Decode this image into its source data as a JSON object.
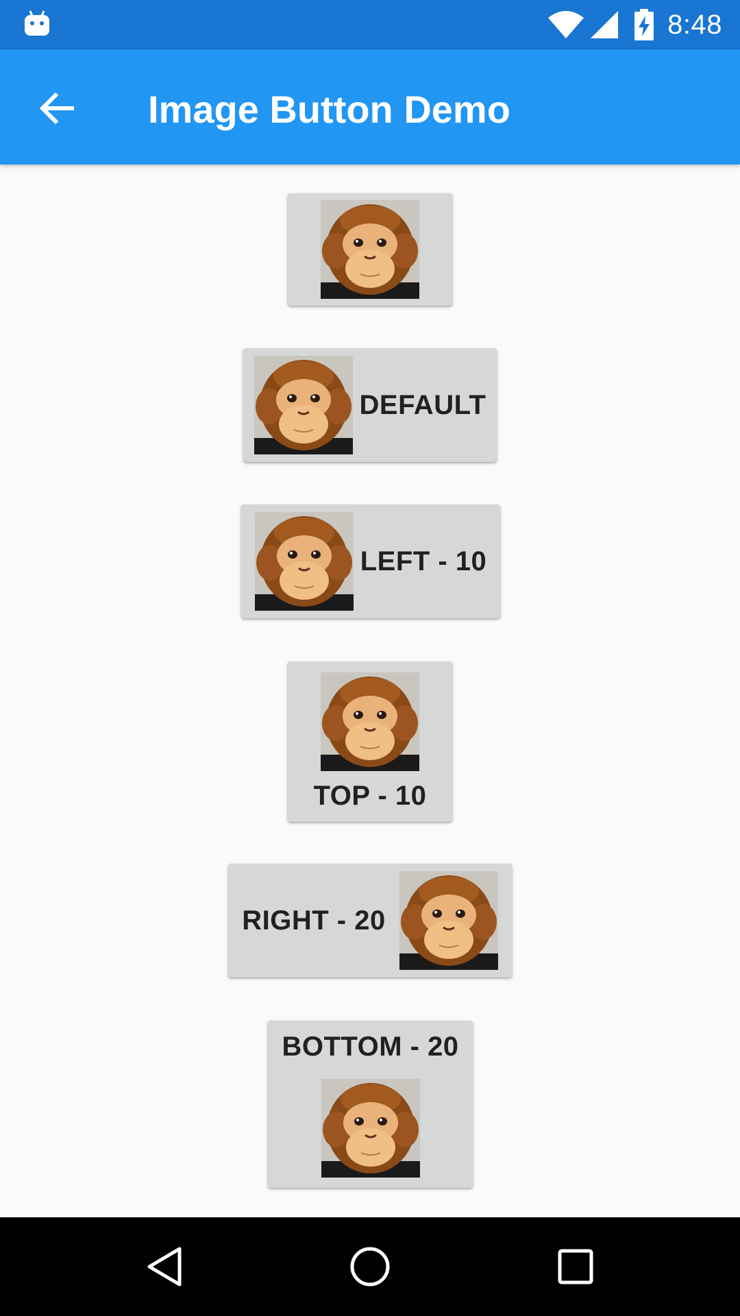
{
  "status_bar": {
    "time": "8:48",
    "icons": [
      "android-notification-icon",
      "wifi-icon",
      "cell-signal-icon",
      "battery-charging-icon"
    ]
  },
  "app_bar": {
    "title": "Image Button Demo",
    "back_icon": "arrow-back-icon"
  },
  "buttons": [
    {
      "id": "image-only",
      "label": "",
      "image": "monkey-image"
    },
    {
      "id": "default",
      "label": "DEFAULT",
      "image": "monkey-image"
    },
    {
      "id": "left-10",
      "label": "LEFT - 10",
      "image": "monkey-image"
    },
    {
      "id": "top-10",
      "label": "TOP - 10",
      "image": "monkey-image"
    },
    {
      "id": "right-20",
      "label": "RIGHT - 20",
      "image": "monkey-image"
    },
    {
      "id": "bottom-20",
      "label": "BOTTOM - 20",
      "image": "monkey-image"
    }
  ],
  "nav_bar": {
    "back": "nav-back-icon",
    "home": "nav-home-icon",
    "recents": "nav-recents-icon"
  },
  "colors": {
    "status_bar": "#1976d2",
    "app_bar": "#2196f3",
    "background": "#fafafa",
    "button": "#d6d7d7",
    "button_text": "#212121",
    "nav_bar": "#000000"
  }
}
